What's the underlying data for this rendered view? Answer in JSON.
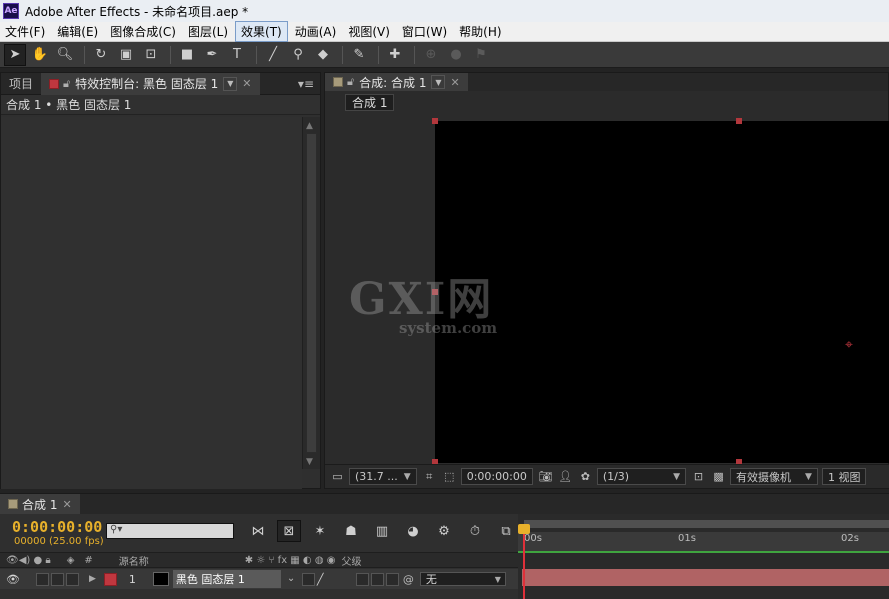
{
  "window": {
    "app_icon": "Ae",
    "title": "Adobe After Effects - 未命名项目.aep *"
  },
  "menu": [
    "文件(F)",
    "编辑(E)",
    "图像合成(C)",
    "图层(L)",
    "效果(T)",
    "动画(A)",
    "视图(V)",
    "窗口(W)",
    "帮助(H)"
  ],
  "left_panel": {
    "tabs": {
      "project": "项目",
      "effect_controls": "特效控制台: 黑色 固态层 1"
    },
    "breadcrumb": "合成 1 • 黑色 固态层 1"
  },
  "composition_panel": {
    "tab": "合成: 合成 1",
    "crumb": "合成 1",
    "watermark_big": "GXI网",
    "watermark_small": "system.com",
    "viewer_bar": {
      "zoom": "(31.7 ...",
      "timecode": "0:00:00:00",
      "resolution": "(1/3)",
      "camera": "有效摄像机",
      "views": "1 视图"
    }
  },
  "timeline": {
    "tab": "合成 1",
    "timecode": "0:00:00:00",
    "fps": "00000 (25.00 fps)",
    "search_placeholder": "",
    "columns": {
      "num": "#",
      "source": "源名称",
      "switches": "✱ ☼ ⑂ fx ▦ ◐ ◍ ◉",
      "parent": "父级"
    },
    "layer": {
      "index": "1",
      "name": "黑色 固态层 1",
      "parent": "无",
      "color": "#b0383f"
    },
    "ruler": [
      "00s",
      "01s",
      "02s"
    ]
  }
}
